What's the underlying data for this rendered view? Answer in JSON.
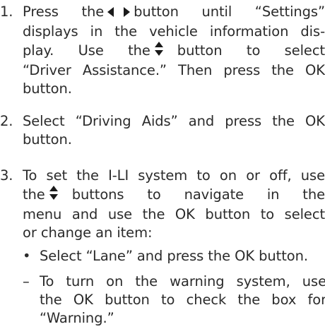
{
  "steps": [
    {
      "number": "1.",
      "l1a": "Press the",
      "icon1": "left-right-arrows-icon",
      "l1b": "button until “Settings”",
      "l2": "displays in the vehicle information dis-",
      "l3a": "play. Use the",
      "icon2": "up-down-arrows-icon",
      "l3b": "button to select",
      "l4": "“Driver Assistance.” Then press the OK",
      "l5": "button."
    },
    {
      "number": "2.",
      "l1": "Select “Driving Aids” and press the OK",
      "l2": "button."
    },
    {
      "number": "3.",
      "l1": "To set the I-LI system to on or off, use",
      "l2a": "the",
      "icon": "up-down-arrows-icon",
      "l2b": "buttons to navigate in the",
      "l3": "menu and use the OK button to select",
      "l4": "or change an item:"
    }
  ],
  "bullets": [
    {
      "marker": "•",
      "text": "Select “Lane” and press the OK button."
    }
  ],
  "dashes": [
    {
      "marker": "–",
      "l1": "To turn on the warning system, use",
      "l2": "the OK button to check the box for",
      "l3": "“Warning.”"
    }
  ]
}
